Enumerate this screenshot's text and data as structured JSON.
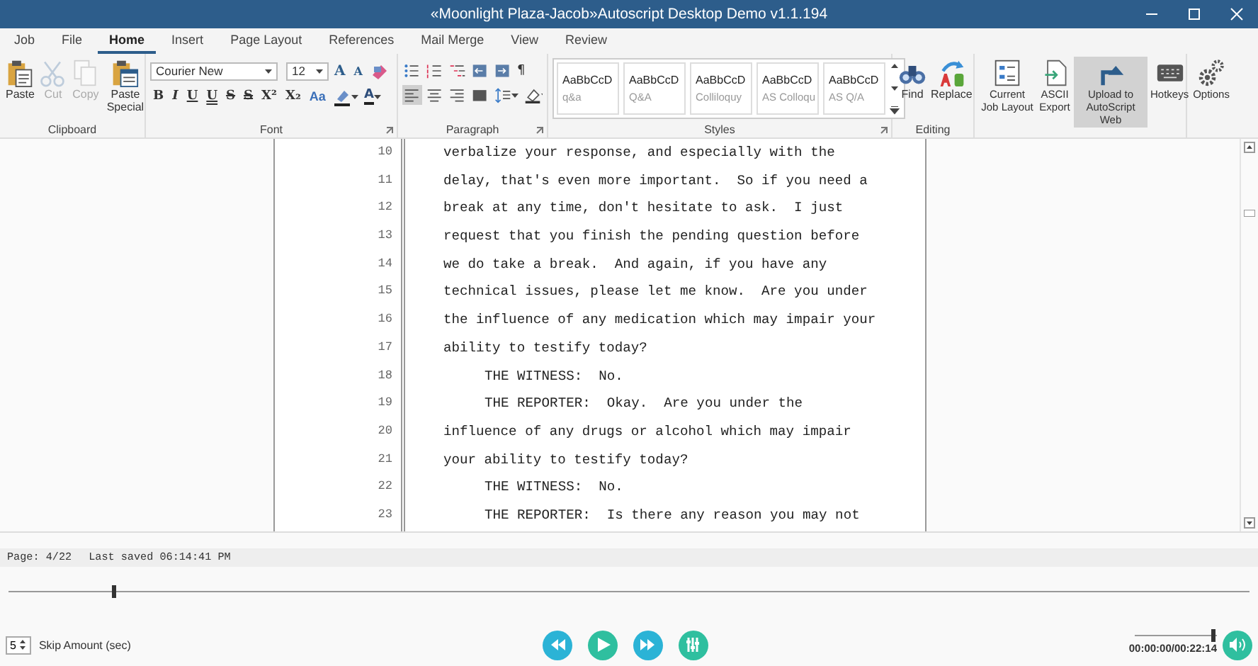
{
  "window": {
    "title": "«Moonlight Plaza-Jacob»Autoscript Desktop Demo v1.1.194"
  },
  "tabs": [
    {
      "label": "Job",
      "selected": false
    },
    {
      "label": "File",
      "selected": false
    },
    {
      "label": "Home",
      "selected": true
    },
    {
      "label": "Insert",
      "selected": false
    },
    {
      "label": "Page Layout",
      "selected": false
    },
    {
      "label": "References",
      "selected": false
    },
    {
      "label": "Mail Merge",
      "selected": false
    },
    {
      "label": "View",
      "selected": false
    },
    {
      "label": "Review",
      "selected": false
    }
  ],
  "ribbon": {
    "clipboard": {
      "label": "Clipboard",
      "buttons": [
        {
          "kind": "paste",
          "label": "Paste",
          "disabled": false
        },
        {
          "kind": "cut",
          "label": "Cut",
          "disabled": true
        },
        {
          "kind": "copy",
          "label": "Copy",
          "disabled": true
        },
        {
          "kind": "paste-special",
          "label": "Paste Special",
          "disabled": false
        }
      ]
    },
    "font": {
      "label": "Font",
      "font_name": "Courier New",
      "font_size": "12",
      "size_tools": [
        {
          "kind": "grow",
          "label": "A"
        },
        {
          "kind": "shrink",
          "label": "A"
        },
        {
          "kind": "clear"
        }
      ],
      "format_buttons": [
        {
          "kind": "bold",
          "label": "B"
        },
        {
          "kind": "italic",
          "label": "I"
        },
        {
          "kind": "underline",
          "label": "U"
        },
        {
          "kind": "double-underline",
          "label": "U"
        },
        {
          "kind": "strike",
          "label": "S"
        },
        {
          "kind": "double-strike",
          "label": "S"
        },
        {
          "kind": "superscript",
          "label": "X²"
        },
        {
          "kind": "subscript",
          "label": "X₂"
        },
        {
          "kind": "case",
          "label": "Aa"
        }
      ],
      "color_tools": [
        {
          "kind": "highlight"
        },
        {
          "kind": "font-color",
          "label": "A"
        }
      ]
    },
    "paragraph": {
      "label": "Paragraph",
      "buttons": [
        {
          "kind": "bullets",
          "pressed": false
        },
        {
          "kind": "numbering",
          "pressed": false
        },
        {
          "kind": "multilevel",
          "pressed": false
        },
        {
          "kind": "outdent",
          "pressed": false
        },
        {
          "kind": "indent",
          "pressed": false
        },
        {
          "kind": "pilcrow",
          "label": "¶",
          "pressed": false
        },
        {
          "kind": "align-left",
          "pressed": true
        },
        {
          "kind": "align-center",
          "pressed": false
        },
        {
          "kind": "align-right",
          "pressed": false
        },
        {
          "kind": "justify",
          "pressed": false
        },
        {
          "kind": "spacing",
          "pressed": false
        },
        {
          "kind": "shading",
          "pressed": false
        }
      ]
    },
    "styles": {
      "label": "Styles",
      "items": [
        {
          "preview": "AaBbCcD",
          "name": "q&a"
        },
        {
          "preview": "AaBbCcD",
          "name": "Q&A"
        },
        {
          "preview": "AaBbCcD",
          "name": "Colliloquy"
        },
        {
          "preview": "AaBbCcD",
          "name": "AS Colloqu"
        },
        {
          "preview": "AaBbCcD",
          "name": "AS Q/A"
        }
      ]
    },
    "editing": {
      "label": "Editing",
      "buttons": [
        {
          "kind": "find",
          "label": "Find"
        },
        {
          "kind": "replace",
          "label": "Replace"
        }
      ]
    },
    "tools": [
      {
        "kind": "layout",
        "label": "Current Job Layout",
        "highlighted": false
      },
      {
        "kind": "export",
        "label": "ASCII Export",
        "highlighted": false
      },
      {
        "kind": "upload",
        "label": "Upload to AutoScript Web",
        "highlighted": true
      },
      {
        "kind": "hotkeys",
        "label": "Hotkeys",
        "highlighted": false
      },
      {
        "kind": "options",
        "label": "Options",
        "highlighted": false
      }
    ]
  },
  "document": {
    "lines": [
      {
        "number": "10",
        "text": "verbalize your response, and especially with the",
        "indented": false
      },
      {
        "number": "11",
        "text": "delay, that's even more important.  So if you need a",
        "indented": false
      },
      {
        "number": "12",
        "text": "break at any time, don't hesitate to ask.  I just",
        "indented": false
      },
      {
        "number": "13",
        "text": "request that you finish the pending question before",
        "indented": false
      },
      {
        "number": "14",
        "text": "we do take a break.  And again, if you have any",
        "indented": false
      },
      {
        "number": "15",
        "text": "technical issues, please let me know.  Are you under",
        "indented": false
      },
      {
        "number": "16",
        "text": "the influence of any medication which may impair your",
        "indented": false
      },
      {
        "number": "17",
        "text": "ability to testify today?",
        "indented": false
      },
      {
        "number": "18",
        "text": "THE WITNESS:  No.",
        "indented": true
      },
      {
        "number": "19",
        "text": "THE REPORTER:  Okay.  Are you under the",
        "indented": true
      },
      {
        "number": "20",
        "text": "influence of any drugs or alcohol which may impair",
        "indented": false
      },
      {
        "number": "21",
        "text": "your ability to testify today?",
        "indented": false
      },
      {
        "number": "22",
        "text": "THE WITNESS:  No.",
        "indented": true
      },
      {
        "number": "23",
        "text": "THE REPORTER:  Is there any reason you may not",
        "indented": true
      }
    ]
  },
  "status_bar": {
    "page": "Page: 4/22",
    "last_saved": "Last saved 06:14:41 PM"
  },
  "player": {
    "timeline": {
      "level": 0.085
    },
    "skip": {
      "value": "5",
      "label": "Skip Amount (sec)"
    },
    "buttons": [
      {
        "kind": "rewind"
      },
      {
        "kind": "play"
      },
      {
        "kind": "forward"
      },
      {
        "kind": "mixer"
      }
    ],
    "volume": {
      "level": 1
    },
    "time": "00:00:00/00:22:14"
  }
}
